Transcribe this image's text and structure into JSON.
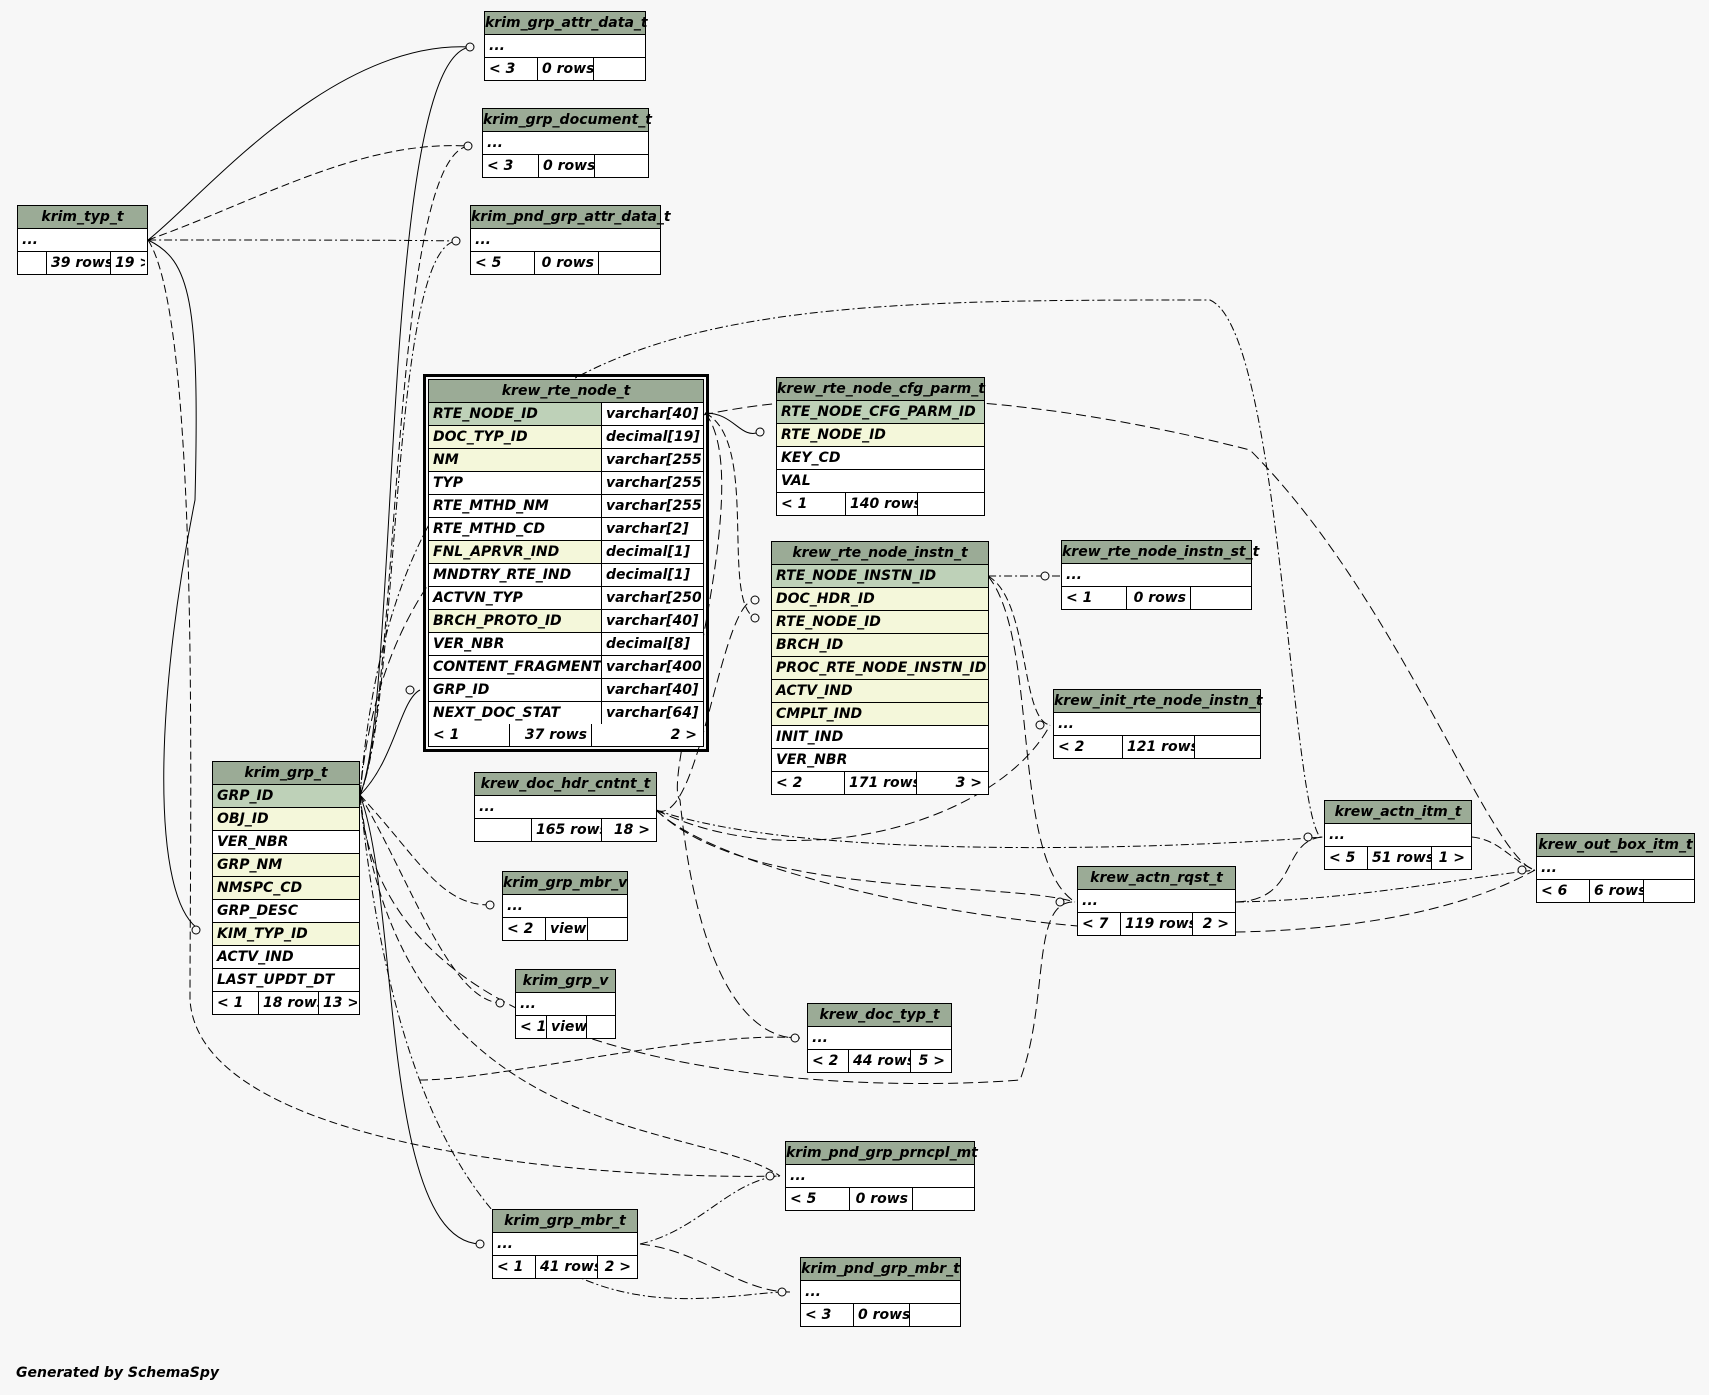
{
  "credit": "Generated by SchemaSpy",
  "tables": {
    "krim_grp_attr_data_t": {
      "title": "krim_grp_attr_data_t",
      "row": "...",
      "parents": "< 3",
      "rows": "0 rows",
      "children": ""
    },
    "krim_grp_document_t": {
      "title": "krim_grp_document_t",
      "row": "...",
      "parents": "< 3",
      "rows": "0 rows",
      "children": ""
    },
    "krim_pnd_grp_attr_data_t": {
      "title": "krim_pnd_grp_attr_data_t",
      "row": "...",
      "parents": "< 5",
      "rows": "0 rows",
      "children": ""
    },
    "krim_typ_t": {
      "title": "krim_typ_t",
      "row": "...",
      "parents": "",
      "rows": "39 rows",
      "children": "19 >"
    },
    "krew_rte_node_cfg_parm_t": {
      "title": "krew_rte_node_cfg_parm_t",
      "cols": [
        "RTE_NODE_CFG_PARM_ID",
        "RTE_NODE_ID",
        "KEY_CD",
        "VAL"
      ],
      "parents": "< 1",
      "rows": "140 rows",
      "children": ""
    },
    "krew_rte_node_instn_t": {
      "title": "krew_rte_node_instn_t",
      "cols": [
        "RTE_NODE_INSTN_ID",
        "DOC_HDR_ID",
        "RTE_NODE_ID",
        "BRCH_ID",
        "PROC_RTE_NODE_INSTN_ID",
        "ACTV_IND",
        "CMPLT_IND",
        "INIT_IND",
        "VER_NBR"
      ],
      "parents": "< 2",
      "rows": "171 rows",
      "children": "3 >"
    },
    "krew_rte_node_instn_st_t": {
      "title": "krew_rte_node_instn_st_t",
      "row": "...",
      "parents": "< 1",
      "rows": "0 rows",
      "children": ""
    },
    "krew_init_rte_node_instn_t": {
      "title": "krew_init_rte_node_instn_t",
      "row": "...",
      "parents": "< 2",
      "rows": "121 rows",
      "children": ""
    },
    "krew_doc_hdr_cntnt_t": {
      "title": "krew_doc_hdr_cntnt_t",
      "row": "...",
      "parents": "",
      "rows": "165 rows",
      "children": "18 >"
    },
    "krim_grp_t": {
      "title": "krim_grp_t",
      "cols": [
        "GRP_ID",
        "OBJ_ID",
        "VER_NBR",
        "GRP_NM",
        "NMSPC_CD",
        "GRP_DESC",
        "KIM_TYP_ID",
        "ACTV_IND",
        "LAST_UPDT_DT"
      ],
      "parents": "< 1",
      "rows": "18 rows",
      "children": "13 >"
    },
    "krim_grp_mbr_v": {
      "title": "krim_grp_mbr_v",
      "row": "...",
      "parents": "< 2",
      "rows": "view",
      "children": ""
    },
    "krim_grp_v": {
      "title": "krim_grp_v",
      "row": "...",
      "parents": "< 1",
      "rows": "view",
      "children": ""
    },
    "krew_doc_typ_t": {
      "title": "krew_doc_typ_t",
      "row": "...",
      "parents": "< 2",
      "rows": "44 rows",
      "children": "5 >"
    },
    "krew_actn_itm_t": {
      "title": "krew_actn_itm_t",
      "row": "...",
      "parents": "< 5",
      "rows": "51 rows",
      "children": "1 >"
    },
    "krew_actn_rqst_t": {
      "title": "krew_actn_rqst_t",
      "row": "...",
      "parents": "< 7",
      "rows": "119 rows",
      "children": "2 >"
    },
    "krew_out_box_itm_t": {
      "title": "krew_out_box_itm_t",
      "row": "...",
      "parents": "< 6",
      "rows": "6 rows",
      "children": ""
    },
    "krim_pnd_grp_prncpl_mt": {
      "title": "krim_pnd_grp_prncpl_mt",
      "row": "...",
      "parents": "< 5",
      "rows": "0 rows",
      "children": ""
    },
    "krim_grp_mbr_t": {
      "title": "krim_grp_mbr_t",
      "row": "...",
      "parents": "< 1",
      "rows": "41 rows",
      "children": "2 >"
    },
    "krim_pnd_grp_mbr_t": {
      "title": "krim_pnd_grp_mbr_t",
      "row": "...",
      "parents": "< 3",
      "rows": "0 rows",
      "children": ""
    }
  },
  "focus_table": {
    "title": "krew_rte_node_t",
    "columns": [
      {
        "name": "RTE_NODE_ID",
        "type": "varchar[40]"
      },
      {
        "name": "DOC_TYP_ID",
        "type": "decimal[19]"
      },
      {
        "name": "NM",
        "type": "varchar[255]"
      },
      {
        "name": "TYP",
        "type": "varchar[255]"
      },
      {
        "name": "RTE_MTHD_NM",
        "type": "varchar[255]"
      },
      {
        "name": "RTE_MTHD_CD",
        "type": "varchar[2]"
      },
      {
        "name": "FNL_APRVR_IND",
        "type": "decimal[1]"
      },
      {
        "name": "MNDTRY_RTE_IND",
        "type": "decimal[1]"
      },
      {
        "name": "ACTVN_TYP",
        "type": "varchar[250]"
      },
      {
        "name": "BRCH_PROTO_ID",
        "type": "varchar[40]"
      },
      {
        "name": "VER_NBR",
        "type": "decimal[8]"
      },
      {
        "name": "CONTENT_FRAGMENT",
        "type": "varchar[4000]"
      },
      {
        "name": "GRP_ID",
        "type": "varchar[40]"
      },
      {
        "name": "NEXT_DOC_STAT",
        "type": "varchar[64]"
      }
    ],
    "parents": "< 1",
    "rows": "37 rows",
    "children": "2 >"
  }
}
